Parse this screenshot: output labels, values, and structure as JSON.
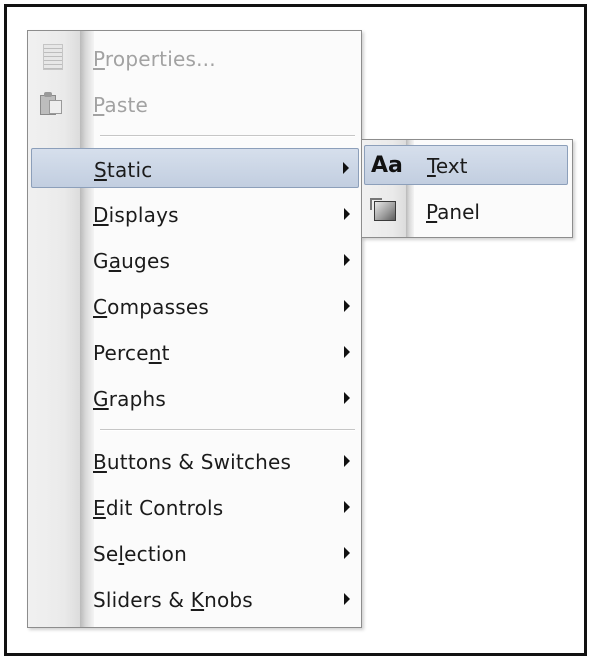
{
  "menu": {
    "items": [
      {
        "pre": "",
        "key": "P",
        "post": "roperties...",
        "disabled": true,
        "icon": "properties-icon",
        "submenu": false
      },
      {
        "pre": "",
        "key": "P",
        "post": "aste",
        "disabled": true,
        "icon": "paste-icon",
        "submenu": false
      },
      {
        "pre": "",
        "key": "S",
        "post": "tatic",
        "disabled": false,
        "submenu": true,
        "highlighted": true
      },
      {
        "pre": "",
        "key": "D",
        "post": "isplays",
        "disabled": false,
        "submenu": true
      },
      {
        "pre": "G",
        "key": "a",
        "post": "uges",
        "disabled": false,
        "submenu": true
      },
      {
        "pre": "",
        "key": "C",
        "post": "ompasses",
        "disabled": false,
        "submenu": true
      },
      {
        "pre": "Perce",
        "key": "n",
        "post": "t",
        "disabled": false,
        "submenu": true
      },
      {
        "pre": "",
        "key": "G",
        "post": "raphs",
        "disabled": false,
        "submenu": true
      },
      {
        "pre": "",
        "key": "B",
        "post": "uttons & Switches",
        "disabled": false,
        "submenu": true
      },
      {
        "pre": "",
        "key": "E",
        "post": "dit Controls",
        "disabled": false,
        "submenu": true
      },
      {
        "pre": "Se",
        "key": "l",
        "post": "ection",
        "disabled": false,
        "submenu": true
      },
      {
        "pre": "Sliders & ",
        "key": "K",
        "post": "nobs",
        "disabled": false,
        "submenu": true
      }
    ]
  },
  "submenu": {
    "items": [
      {
        "icon_text": "Aa",
        "pre": "",
        "key": "T",
        "post": "ext",
        "highlighted": true
      },
      {
        "pre": "",
        "key": "P",
        "post": "anel",
        "highlighted": false
      }
    ]
  }
}
